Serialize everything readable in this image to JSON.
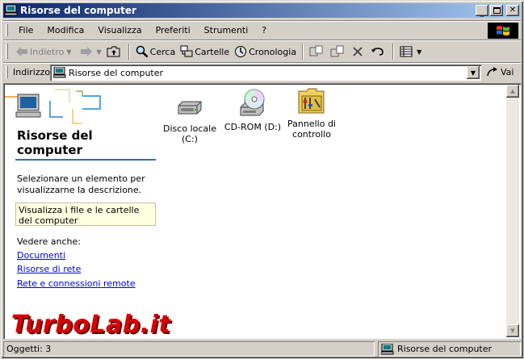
{
  "window": {
    "title": "Risorse del computer"
  },
  "menu": [
    "File",
    "Modifica",
    "Visualizza",
    "Preferiti",
    "Strumenti",
    "?"
  ],
  "toolbar": {
    "back_label": "Indietro",
    "search_label": "Cerca",
    "folders_label": "Cartelle",
    "history_label": "Cronologia"
  },
  "address": {
    "label": "Indirizzo",
    "value": "Risorse del computer",
    "go_label": "Vai"
  },
  "webview": {
    "title_line1": "Risorse del",
    "title_line2": "computer",
    "description": "Selezionare un elemento per visualizzarne la descrizione.",
    "tip": "Visualizza i file e le cartelle del computer",
    "see_also_label": "Vedere anche:",
    "links": [
      "Documenti",
      "Risorse di rete",
      "Rete e connessioni remote"
    ]
  },
  "items": [
    {
      "line1": "Disco locale",
      "line2": "(C:)",
      "icon": "hard-drive-icon"
    },
    {
      "line1": "CD-ROM (D:)",
      "line2": "",
      "icon": "cd-rom-icon"
    },
    {
      "line1": "Pannello di",
      "line2": "controllo",
      "icon": "control-panel-icon"
    }
  ],
  "status": {
    "count": "Oggetti: 3",
    "location": "Risorse del computer"
  },
  "watermark": "TurboLab.it",
  "colors": {
    "titlebar_start": "#0a246a",
    "titlebar_end": "#a6caf0",
    "link": "#0000ee",
    "tip_bg": "#ffffe1"
  }
}
